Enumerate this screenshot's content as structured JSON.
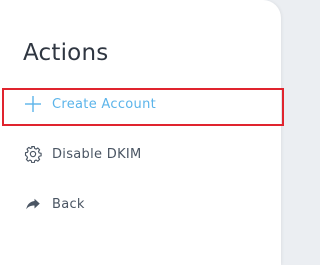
{
  "panel": {
    "title": "Actions",
    "actions": [
      {
        "label": "Create Account",
        "icon": "plus-icon",
        "color": "#5bb4ea",
        "highlighted": true
      },
      {
        "label": "Disable DKIM",
        "icon": "gear-icon",
        "color": "#4a5563"
      },
      {
        "label": "Back",
        "icon": "share-arrow-icon",
        "color": "#4a5563"
      }
    ]
  },
  "colors": {
    "accent": "#5bb4ea",
    "highlight_border": "#e0242e",
    "text": "#4a5563",
    "title": "#2f3641"
  }
}
